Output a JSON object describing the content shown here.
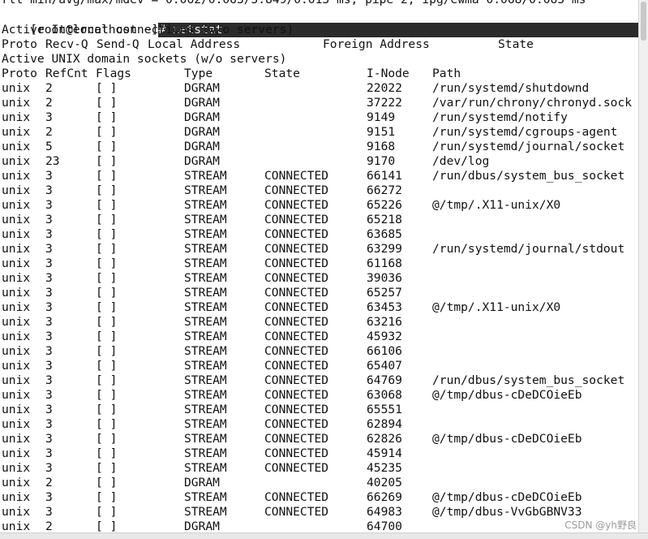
{
  "terminal": {
    "top_cut_line": "rtt min/avg/max/mdev = 0.062/0.063/5.849/0.013 ms, pipe 2, ipg/ewma 0.068/0.065 ms",
    "prompt": "[root@localhost ~]",
    "command": "# netstat",
    "inet_title": "Active Internet connections (w/o servers)",
    "inet_headers": {
      "proto": "Proto",
      "recvq": "Recv-Q",
      "sendq": "Send-Q",
      "local": "Local Address",
      "foreign": "Foreign Address",
      "state": "State"
    },
    "unix_title": "Active UNIX domain sockets (w/o servers)",
    "unix_headers": {
      "proto": "Proto",
      "refcnt": "RefCnt",
      "flags": "Flags",
      "type": "Type",
      "state": "State",
      "inode": "I-Node",
      "path": "Path"
    },
    "rows": [
      {
        "proto": "unix",
        "refcnt": "2",
        "flags": "[ ]",
        "type": "DGRAM",
        "state": "",
        "inode": "22022",
        "path": "/run/systemd/shutdownd"
      },
      {
        "proto": "unix",
        "refcnt": "2",
        "flags": "[ ]",
        "type": "DGRAM",
        "state": "",
        "inode": "37222",
        "path": "/var/run/chrony/chronyd.sock"
      },
      {
        "proto": "unix",
        "refcnt": "3",
        "flags": "[ ]",
        "type": "DGRAM",
        "state": "",
        "inode": "9149",
        "path": "/run/systemd/notify"
      },
      {
        "proto": "unix",
        "refcnt": "2",
        "flags": "[ ]",
        "type": "DGRAM",
        "state": "",
        "inode": "9151",
        "path": "/run/systemd/cgroups-agent"
      },
      {
        "proto": "unix",
        "refcnt": "5",
        "flags": "[ ]",
        "type": "DGRAM",
        "state": "",
        "inode": "9168",
        "path": "/run/systemd/journal/socket"
      },
      {
        "proto": "unix",
        "refcnt": "23",
        "flags": "[ ]",
        "type": "DGRAM",
        "state": "",
        "inode": "9170",
        "path": "/dev/log"
      },
      {
        "proto": "unix",
        "refcnt": "3",
        "flags": "[ ]",
        "type": "STREAM",
        "state": "CONNECTED",
        "inode": "66141",
        "path": "/run/dbus/system_bus_socket"
      },
      {
        "proto": "unix",
        "refcnt": "3",
        "flags": "[ ]",
        "type": "STREAM",
        "state": "CONNECTED",
        "inode": "66272",
        "path": ""
      },
      {
        "proto": "unix",
        "refcnt": "3",
        "flags": "[ ]",
        "type": "STREAM",
        "state": "CONNECTED",
        "inode": "65226",
        "path": "@/tmp/.X11-unix/X0"
      },
      {
        "proto": "unix",
        "refcnt": "3",
        "flags": "[ ]",
        "type": "STREAM",
        "state": "CONNECTED",
        "inode": "65218",
        "path": ""
      },
      {
        "proto": "unix",
        "refcnt": "3",
        "flags": "[ ]",
        "type": "STREAM",
        "state": "CONNECTED",
        "inode": "63685",
        "path": ""
      },
      {
        "proto": "unix",
        "refcnt": "3",
        "flags": "[ ]",
        "type": "STREAM",
        "state": "CONNECTED",
        "inode": "63299",
        "path": "/run/systemd/journal/stdout"
      },
      {
        "proto": "unix",
        "refcnt": "3",
        "flags": "[ ]",
        "type": "STREAM",
        "state": "CONNECTED",
        "inode": "61168",
        "path": ""
      },
      {
        "proto": "unix",
        "refcnt": "3",
        "flags": "[ ]",
        "type": "STREAM",
        "state": "CONNECTED",
        "inode": "39036",
        "path": ""
      },
      {
        "proto": "unix",
        "refcnt": "3",
        "flags": "[ ]",
        "type": "STREAM",
        "state": "CONNECTED",
        "inode": "65257",
        "path": ""
      },
      {
        "proto": "unix",
        "refcnt": "3",
        "flags": "[ ]",
        "type": "STREAM",
        "state": "CONNECTED",
        "inode": "63453",
        "path": "@/tmp/.X11-unix/X0"
      },
      {
        "proto": "unix",
        "refcnt": "3",
        "flags": "[ ]",
        "type": "STREAM",
        "state": "CONNECTED",
        "inode": "63216",
        "path": ""
      },
      {
        "proto": "unix",
        "refcnt": "3",
        "flags": "[ ]",
        "type": "STREAM",
        "state": "CONNECTED",
        "inode": "45932",
        "path": ""
      },
      {
        "proto": "unix",
        "refcnt": "3",
        "flags": "[ ]",
        "type": "STREAM",
        "state": "CONNECTED",
        "inode": "66106",
        "path": ""
      },
      {
        "proto": "unix",
        "refcnt": "3",
        "flags": "[ ]",
        "type": "STREAM",
        "state": "CONNECTED",
        "inode": "65407",
        "path": ""
      },
      {
        "proto": "unix",
        "refcnt": "3",
        "flags": "[ ]",
        "type": "STREAM",
        "state": "CONNECTED",
        "inode": "64769",
        "path": "/run/dbus/system_bus_socket"
      },
      {
        "proto": "unix",
        "refcnt": "3",
        "flags": "[ ]",
        "type": "STREAM",
        "state": "CONNECTED",
        "inode": "63068",
        "path": "@/tmp/dbus-cDeDCOieEb"
      },
      {
        "proto": "unix",
        "refcnt": "3",
        "flags": "[ ]",
        "type": "STREAM",
        "state": "CONNECTED",
        "inode": "65551",
        "path": ""
      },
      {
        "proto": "unix",
        "refcnt": "3",
        "flags": "[ ]",
        "type": "STREAM",
        "state": "CONNECTED",
        "inode": "62894",
        "path": ""
      },
      {
        "proto": "unix",
        "refcnt": "3",
        "flags": "[ ]",
        "type": "STREAM",
        "state": "CONNECTED",
        "inode": "62826",
        "path": "@/tmp/dbus-cDeDCOieEb"
      },
      {
        "proto": "unix",
        "refcnt": "3",
        "flags": "[ ]",
        "type": "STREAM",
        "state": "CONNECTED",
        "inode": "45914",
        "path": ""
      },
      {
        "proto": "unix",
        "refcnt": "3",
        "flags": "[ ]",
        "type": "STREAM",
        "state": "CONNECTED",
        "inode": "45235",
        "path": ""
      },
      {
        "proto": "unix",
        "refcnt": "2",
        "flags": "[ ]",
        "type": "DGRAM",
        "state": "",
        "inode": "40205",
        "path": ""
      },
      {
        "proto": "unix",
        "refcnt": "3",
        "flags": "[ ]",
        "type": "STREAM",
        "state": "CONNECTED",
        "inode": "66269",
        "path": "@/tmp/dbus-cDeDCOieEb"
      },
      {
        "proto": "unix",
        "refcnt": "3",
        "flags": "[ ]",
        "type": "STREAM",
        "state": "CONNECTED",
        "inode": "64983",
        "path": "@/tmp/dbus-VvGbGBNV33"
      },
      {
        "proto": "unix",
        "refcnt": "2",
        "flags": "[ ]",
        "type": "DGRAM",
        "state": "",
        "inode": "64700",
        "path": ""
      }
    ]
  },
  "watermark": "CSDN @yh野良"
}
